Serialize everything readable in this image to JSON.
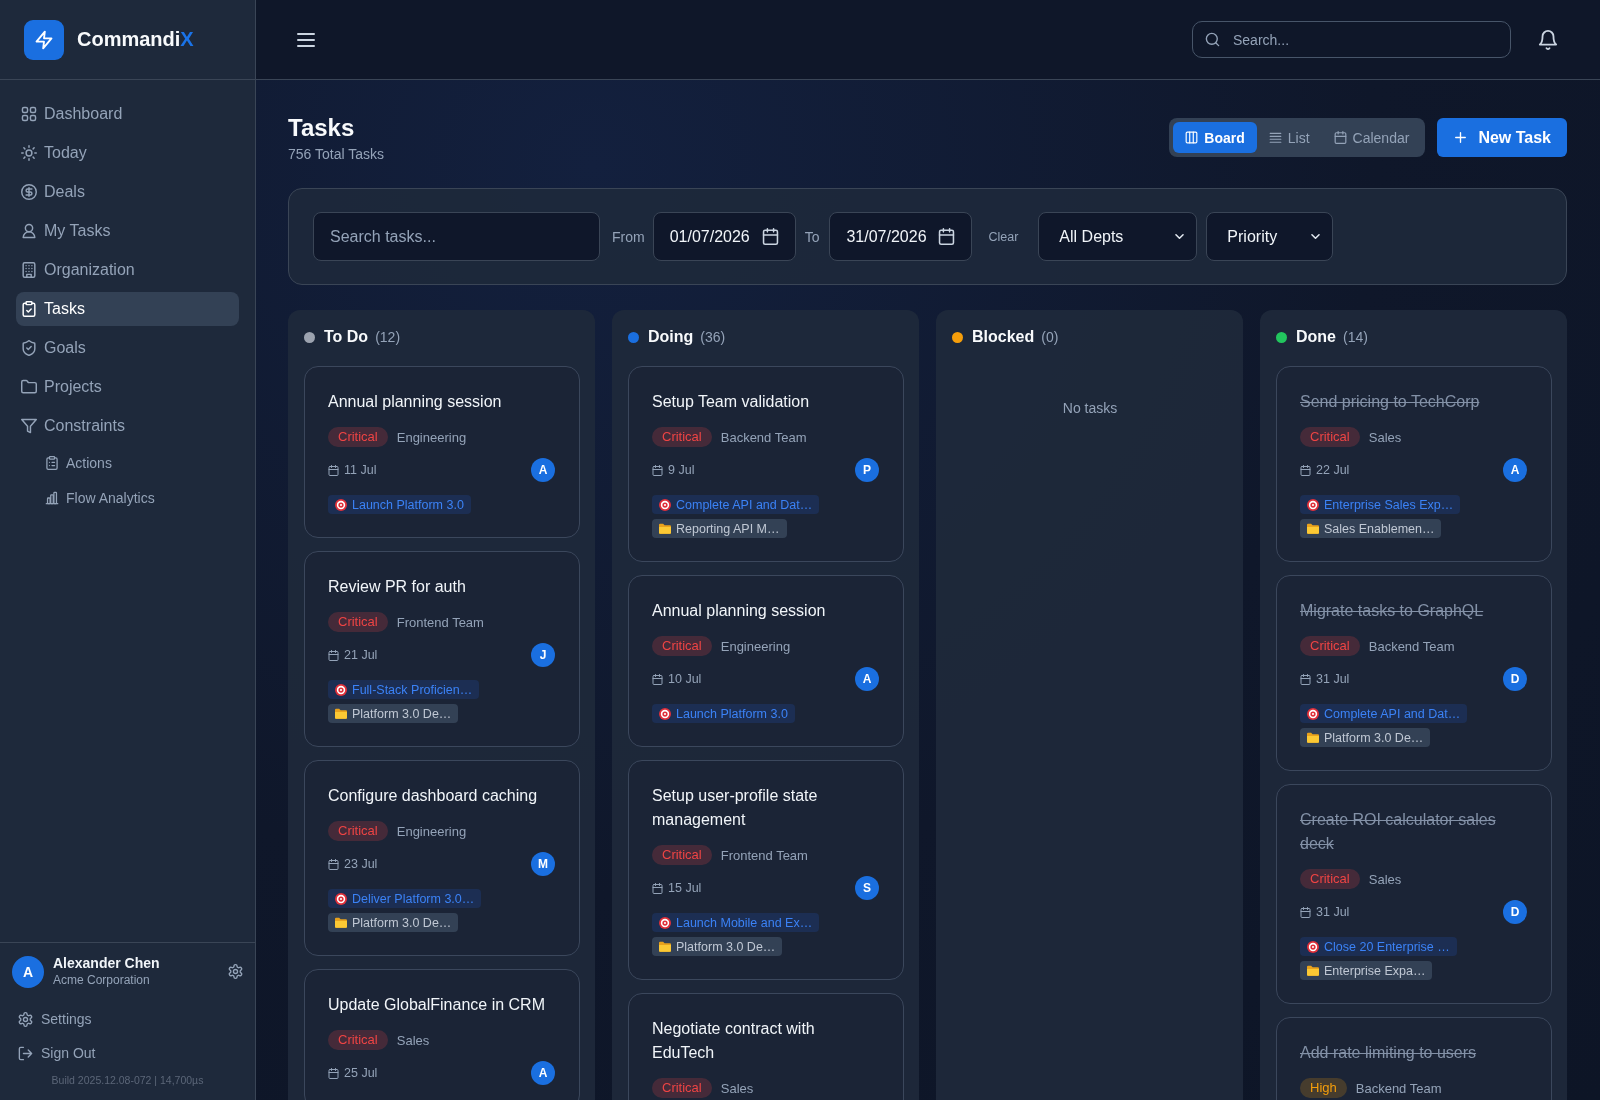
{
  "sidebar": {
    "brand": {
      "name": "Commandi",
      "accent": "X"
    },
    "nav": [
      {
        "label": "Dashboard",
        "selected": false
      },
      {
        "label": "Today",
        "selected": false
      },
      {
        "label": "Deals",
        "selected": false
      },
      {
        "label": "My Tasks",
        "selected": false
      },
      {
        "label": "Organization",
        "selected": false
      },
      {
        "label": "Tasks",
        "selected": true
      },
      {
        "label": "Goals",
        "selected": false
      },
      {
        "label": "Projects",
        "selected": false
      },
      {
        "label": "Constraints",
        "selected": false,
        "children": [
          {
            "label": "Actions",
            "selected": false
          },
          {
            "label": "Flow Analytics",
            "selected": false
          }
        ]
      }
    ],
    "user": {
      "initial": "A",
      "name": "Alexander Chen",
      "company": "Acme Corporation"
    },
    "footer_links": [
      "Settings",
      "Sign Out"
    ],
    "build": "Build 2025.12.08-072 | 14,700µs"
  },
  "header": {
    "search": {
      "placeholder": "Search..."
    }
  },
  "page": {
    "title": "Tasks",
    "subtitle": "756 Total Tasks",
    "views": [
      {
        "label": "Board",
        "selected": true
      },
      {
        "label": "List",
        "selected": false
      },
      {
        "label": "Calendar",
        "selected": false
      }
    ],
    "new_button": "New Task"
  },
  "filters": {
    "search": {
      "placeholder": "Search tasks..."
    },
    "from_label": "From",
    "from": "01/07/2026",
    "to_label": "To",
    "to": "31/07/2026",
    "clear": "Clear",
    "department": "All Depts",
    "priority": "Priority"
  },
  "board": {
    "columns": [
      {
        "title": "To Do",
        "count": "(12)",
        "color": "#9ca3af",
        "cards": [
          {
            "title": "Annual planning session",
            "completed": false,
            "priority": {
              "label": "Critical",
              "kind": "critical"
            },
            "team": "Engineering",
            "due": "11 Jul",
            "assignee": "A",
            "goal": "Launch Platform 3.0"
          },
          {
            "title": "Review PR for auth",
            "completed": false,
            "priority": {
              "label": "Critical",
              "kind": "critical"
            },
            "team": "Frontend Team",
            "due": "21 Jul",
            "assignee": "J",
            "goal": "Full-Stack Proficien…",
            "project": "Platform 3.0 De…"
          },
          {
            "title": "Configure dashboard caching",
            "completed": false,
            "priority": {
              "label": "Critical",
              "kind": "critical"
            },
            "team": "Engineering",
            "due": "23 Jul",
            "assignee": "M",
            "goal": "Deliver Platform 3.0…",
            "project": "Platform 3.0 De…"
          },
          {
            "title": "Update GlobalFinance in CRM",
            "completed": false,
            "priority": {
              "label": "Critical",
              "kind": "critical"
            },
            "team": "Sales",
            "due": "25 Jul",
            "assignee": "A"
          }
        ]
      },
      {
        "title": "Doing",
        "count": "(36)",
        "color": "#1a6fe0",
        "cards": [
          {
            "title": "Setup Team validation",
            "completed": false,
            "priority": {
              "label": "Critical",
              "kind": "critical"
            },
            "team": "Backend Team",
            "due": "9 Jul",
            "assignee": "P",
            "goal": "Complete API and Dat…",
            "project": "Reporting API M…"
          },
          {
            "title": "Annual planning session",
            "completed": false,
            "priority": {
              "label": "Critical",
              "kind": "critical"
            },
            "team": "Engineering",
            "due": "10 Jul",
            "assignee": "A",
            "goal": "Launch Platform 3.0"
          },
          {
            "title": "Setup user-profile state management",
            "completed": false,
            "priority": {
              "label": "Critical",
              "kind": "critical"
            },
            "team": "Frontend Team",
            "due": "15 Jul",
            "assignee": "S",
            "goal": "Launch Mobile and Ex…",
            "project": "Platform 3.0 De…"
          },
          {
            "title": "Negotiate contract with EduTech",
            "completed": false,
            "priority": {
              "label": "Critical",
              "kind": "critical"
            },
            "team": "Sales"
          }
        ]
      },
      {
        "title": "Blocked",
        "count": "(0)",
        "color": "#f59e0b",
        "empty_text": "No tasks"
      },
      {
        "title": "Done",
        "count": "(14)",
        "color": "#22c55e",
        "cards": [
          {
            "title": "Send pricing to TechCorp",
            "completed": true,
            "priority": {
              "label": "Critical",
              "kind": "critical"
            },
            "team": "Sales",
            "due": "22 Jul",
            "assignee": "A",
            "goal": "Enterprise Sales Exp…",
            "project": "Sales Enablemen…"
          },
          {
            "title": "Migrate tasks to GraphQL",
            "completed": true,
            "priority": {
              "label": "Critical",
              "kind": "critical"
            },
            "team": "Backend Team",
            "due": "31 Jul",
            "assignee": "D",
            "goal": "Complete API and Dat…",
            "project": "Platform 3.0 De…"
          },
          {
            "title": "Create ROI calculator sales deck",
            "completed": true,
            "priority": {
              "label": "Critical",
              "kind": "critical"
            },
            "team": "Sales",
            "due": "31 Jul",
            "assignee": "D",
            "goal": "Close 20 Enterprise …",
            "project": "Enterprise Expa…"
          },
          {
            "title": "Add rate limiting to users",
            "completed": true,
            "priority": {
              "label": "High",
              "kind": "high"
            },
            "team": "Backend Team"
          }
        ]
      }
    ]
  }
}
